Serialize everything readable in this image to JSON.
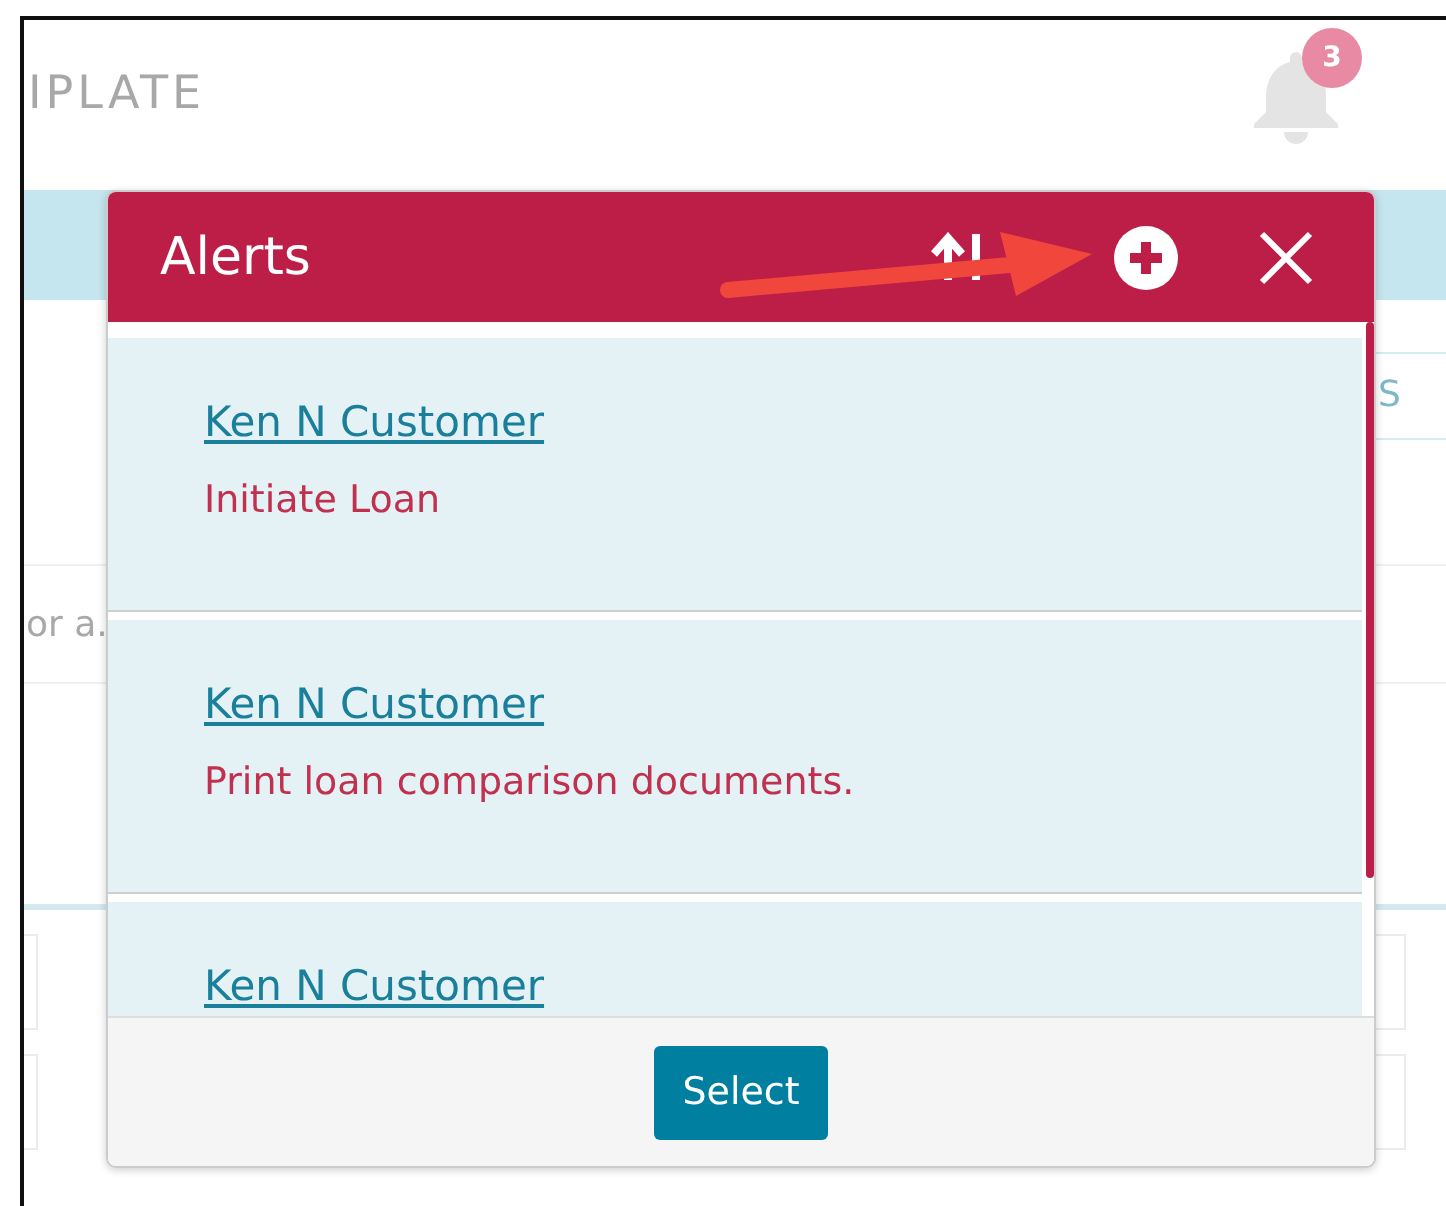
{
  "background": {
    "title": "IPLATE",
    "notification_count": "3",
    "field_text": "S",
    "row_text": "or a."
  },
  "dialog": {
    "title": "Alerts",
    "alerts": [
      {
        "name": "Ken N Customer",
        "message": "Initiate Loan"
      },
      {
        "name": "Ken N Customer",
        "message": "Print loan comparison documents."
      },
      {
        "name": "Ken N Customer"
      }
    ],
    "button": "Select"
  }
}
